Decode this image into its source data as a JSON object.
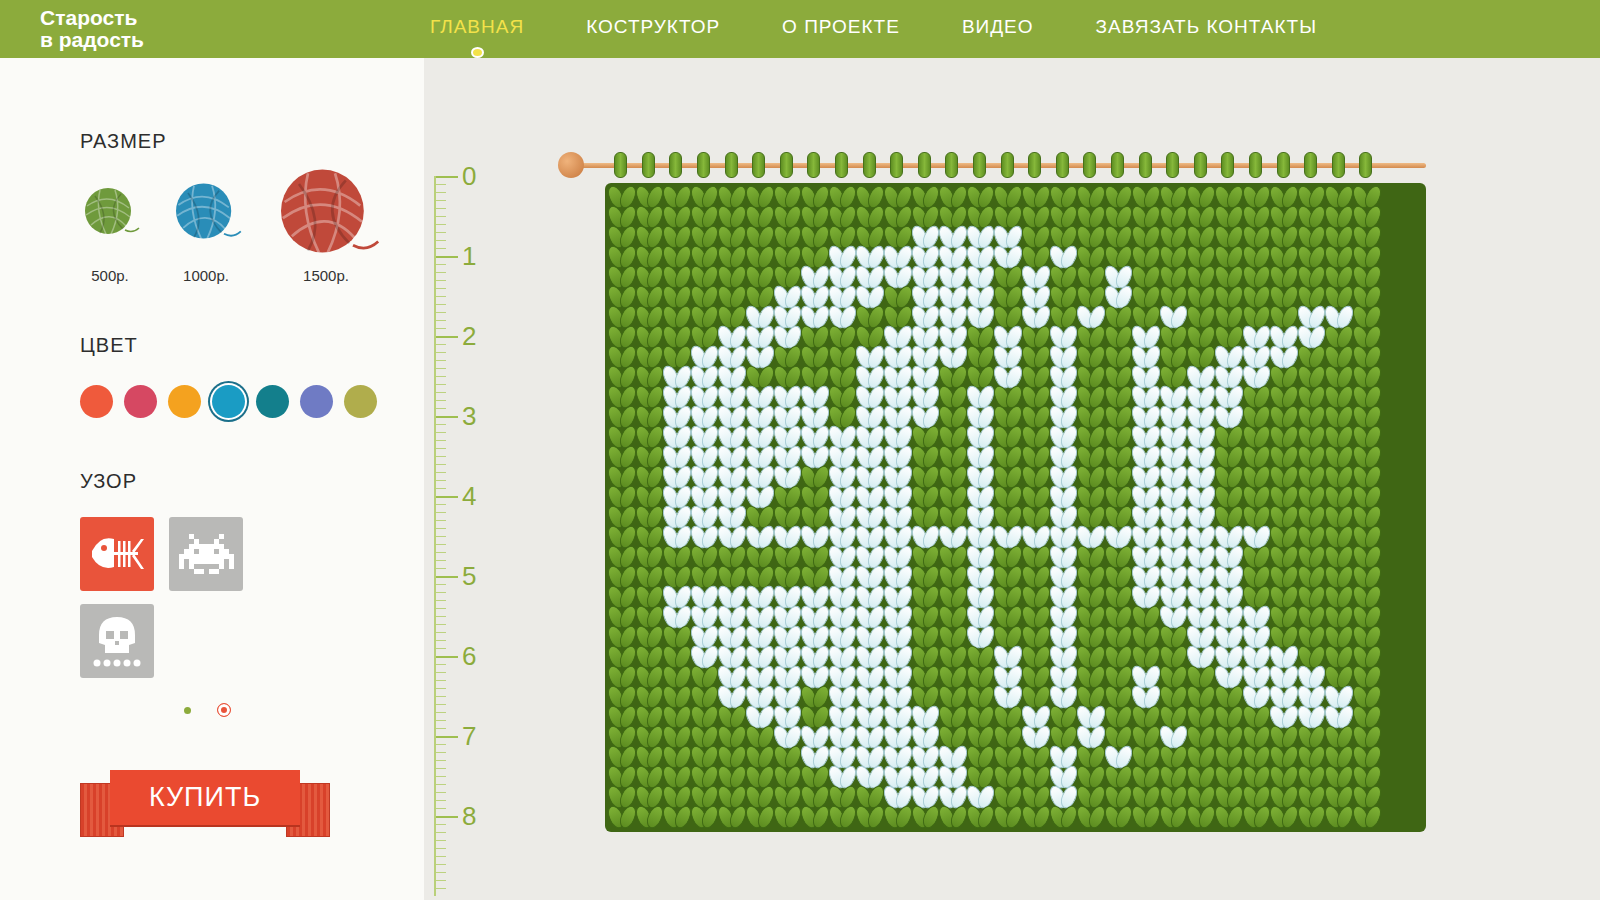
{
  "header": {
    "logo": [
      "Старость",
      "в радость"
    ],
    "nav": [
      {
        "label": "ГЛАВНАЯ",
        "selected": true
      },
      {
        "label": "КОСТРУКТОР",
        "selected": false
      },
      {
        "label": "О ПРОЕКТЕ",
        "selected": false
      },
      {
        "label": "ВИДЕО",
        "selected": false
      },
      {
        "label": "ЗАВЯЗАТЬ КОНТАКТЫ",
        "selected": false
      }
    ]
  },
  "sidebar": {
    "size": {
      "title": "РАЗМЕР",
      "options": [
        {
          "price": "500р.",
          "color": "#6f9a3c",
          "selected": false
        },
        {
          "price": "1000р.",
          "color": "#2a8db8",
          "selected": false
        },
        {
          "price": "1500р.",
          "color": "#c0493a",
          "selected": true
        }
      ]
    },
    "color": {
      "title": "ЦВЕТ",
      "options": [
        {
          "color": "#ef5a3c",
          "selected": false
        },
        {
          "color": "#d64862",
          "selected": false
        },
        {
          "color": "#f4a21f",
          "selected": false
        },
        {
          "color": "#1a9cc4",
          "selected": true
        },
        {
          "color": "#137f8c",
          "selected": false
        },
        {
          "color": "#6f7bc4",
          "selected": false
        },
        {
          "color": "#b0ad4c",
          "selected": false
        }
      ]
    },
    "pattern": {
      "title": "УЗОР",
      "options": [
        {
          "kind": "fish",
          "selected": true
        },
        {
          "kind": "invader",
          "selected": false
        },
        {
          "kind": "skull",
          "selected": false
        }
      ]
    },
    "pages": [
      {
        "selected": false
      },
      {
        "selected": true
      }
    ],
    "buy": "КУПИТЬ"
  },
  "canvas": {
    "ruler": [
      "0",
      "1",
      "2",
      "3",
      "4",
      "5",
      "6",
      "7",
      "8"
    ],
    "stitches": [
      "............................",
      "............................",
      "...........####.............",
      "........#######.#...........",
      ".......#######.#..#.........",
      "......####.###.#..#.........",
      ".....####..###.#.#..#....##.",
      "....###...###.#.#..#...###..",
      "...###...####.#.#..#..###...",
      "..###....###..#.#..#.###....",
      "..######.###.#..#..####.....",
      "..######.###.#..#..####.....",
      "..#########..#..#..###......",
      "..#########..#..#..###......",
      "..#####.###..#..#..###......",
      "..####..###..#..#..###......",
      "..###...###..#..#..###......",
      "..######################....",
      "........###..#..#..####.....",
      "........###..#..#..####.....",
      "..#########..#..#..####.....",
      "..#########..#..#...####....",
      "...########..#..#....###....",
      "...########...#.#....####...",
      "....#######...#.#..#..####..",
      "....###.###...#.#..#...####.",
      ".....##.####...#.#......###.",
      "......######...#.#..#.......",
      ".......######...#.#.........",
      "........#####...#...........",
      "..........####..#...........",
      "............................"
    ]
  }
}
